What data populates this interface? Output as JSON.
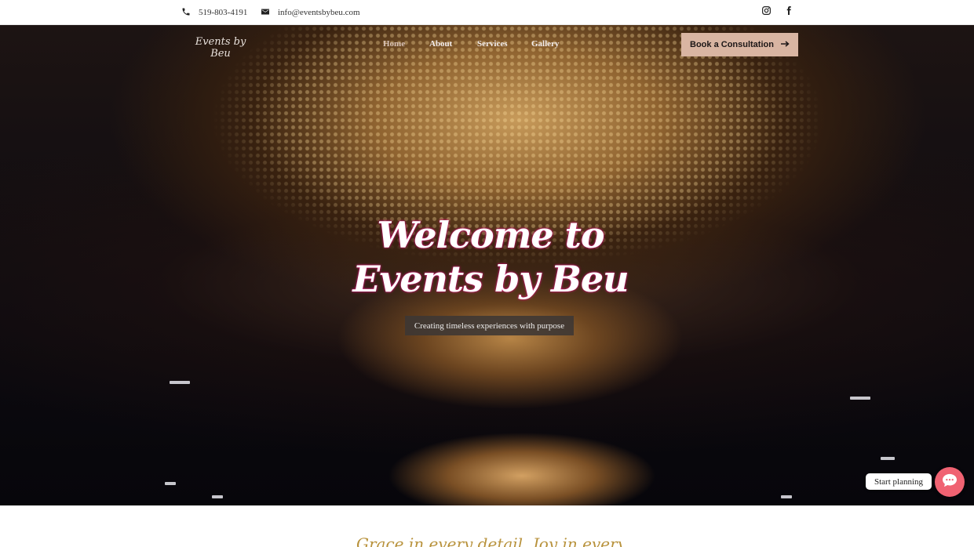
{
  "topbar": {
    "phone": "519-803-4191",
    "email": "info@eventsbybeu.com",
    "icons": [
      "phone-icon",
      "mail-icon",
      "instagram-icon",
      "facebook-icon"
    ]
  },
  "navbar": {
    "logo_text": "Events by Beu",
    "nav_items": [
      {
        "label": "Home",
        "active": true
      },
      {
        "label": "About",
        "active": false
      },
      {
        "label": "Services",
        "active": false
      },
      {
        "label": "Gallery",
        "active": false
      }
    ],
    "cta_label": "Book a Consultation"
  },
  "hero": {
    "headline_line1": "Welcome to",
    "headline_line2": "Events by Beu",
    "tagline": "Creating timeless experiences with purpose"
  },
  "chat": {
    "label": "Start planning"
  },
  "next_section": {
    "script_text": "Grace in every detail. Joy in every moment."
  },
  "colors": {
    "cta_background": "#d9b5a2",
    "chat_button": "#f06272",
    "script_gold": "#b8923c",
    "headline_glow": "#e6127f"
  }
}
